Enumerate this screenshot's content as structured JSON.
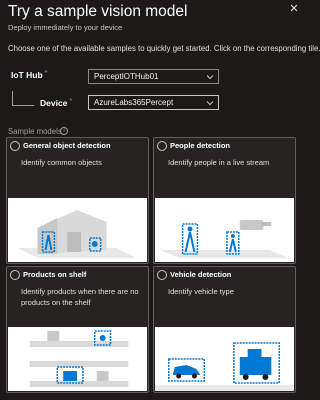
{
  "header": {
    "title": "Try a sample vision model",
    "subtitle": "Deploy immediately to your device"
  },
  "intro": "Choose one of the available samples to quickly get started. Click on the corresponding tile.",
  "form": {
    "iot_hub_label": "IoT Hub",
    "iot_hub_value": "PerceptIOTHub01",
    "device_label": "Device",
    "device_value": "AzureLabs365Percept",
    "required_marker": "*"
  },
  "section": {
    "label": "Sample models",
    "info_glyph": "i"
  },
  "tiles": [
    {
      "title": "General object detection",
      "description": "Identify common objects",
      "icon": "house-illustration"
    },
    {
      "title": "People detection",
      "description": "Identify people in a live stream",
      "icon": "people-camera-illustration"
    },
    {
      "title": "Products on shelf",
      "description": "Identify products when there are no products on the shelf",
      "icon": "shelf-illustration"
    },
    {
      "title": "Vehicle detection",
      "description": "Identify vehicle type",
      "icon": "vehicle-illustration"
    }
  ],
  "colors": {
    "background": "#1b1a19",
    "tile_background": "#252423",
    "detection_box": "#0078d4"
  }
}
